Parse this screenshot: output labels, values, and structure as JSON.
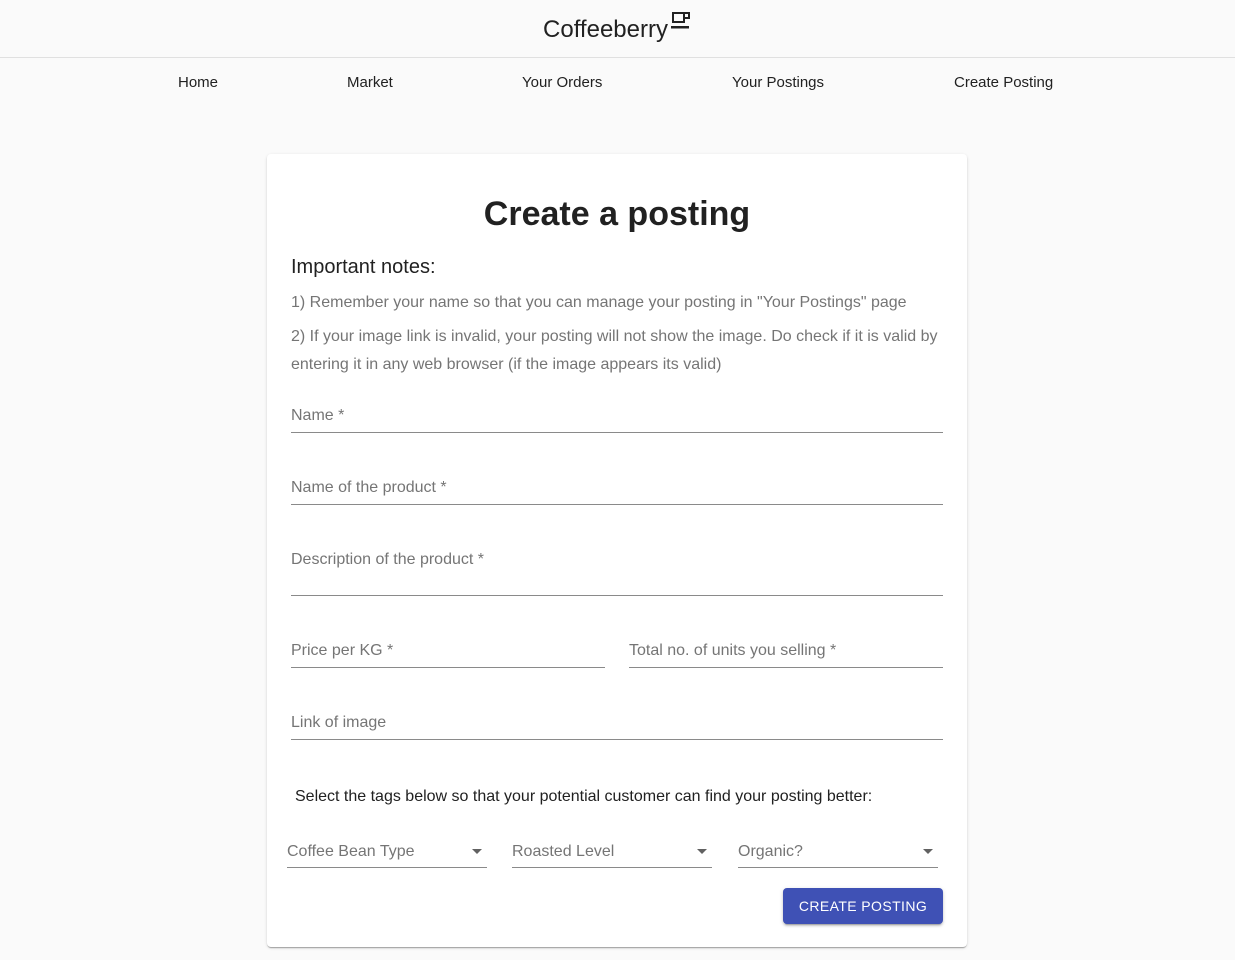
{
  "header": {
    "brand": "Coffeeberry",
    "brand_icon": "coffee-cup-icon"
  },
  "nav": {
    "items": [
      {
        "label": "Home"
      },
      {
        "label": "Market"
      },
      {
        "label": "Your Orders"
      },
      {
        "label": "Your Postings"
      },
      {
        "label": "Create Posting"
      }
    ]
  },
  "form": {
    "title": "Create a posting",
    "notes_heading": "Important notes:",
    "notes": [
      "1) Remember your name so that you can manage your posting in \"Your Postings\" page",
      "2) If your image link is invalid, your posting will not show the image. Do check if it is valid by entering it in any web browser (if the image appears its valid)"
    ],
    "fields": {
      "name": {
        "label": "Name *",
        "value": ""
      },
      "product_name": {
        "label": "Name of the product *",
        "value": ""
      },
      "description": {
        "label": "Description of the product *",
        "value": ""
      },
      "price": {
        "label": "Price per KG *",
        "value": ""
      },
      "units": {
        "label": "Total no. of units you selling *",
        "value": ""
      },
      "image_link": {
        "label": "Link of image",
        "value": ""
      }
    },
    "tags_instruction": "Select the tags below so that your potential customer can find your posting better:",
    "selects": {
      "bean_type": {
        "label": "Coffee Bean Type",
        "icon": "arrow-drop-down-icon"
      },
      "roast_level": {
        "label": "Roasted Level",
        "icon": "arrow-drop-down-icon"
      },
      "organic": {
        "label": "Organic?",
        "icon": "arrow-drop-down-icon"
      }
    },
    "submit_label": "Create Posting"
  },
  "colors": {
    "primary": "#3f51b5",
    "background": "#fafafa",
    "card": "#ffffff",
    "label_grey": "#757575"
  }
}
